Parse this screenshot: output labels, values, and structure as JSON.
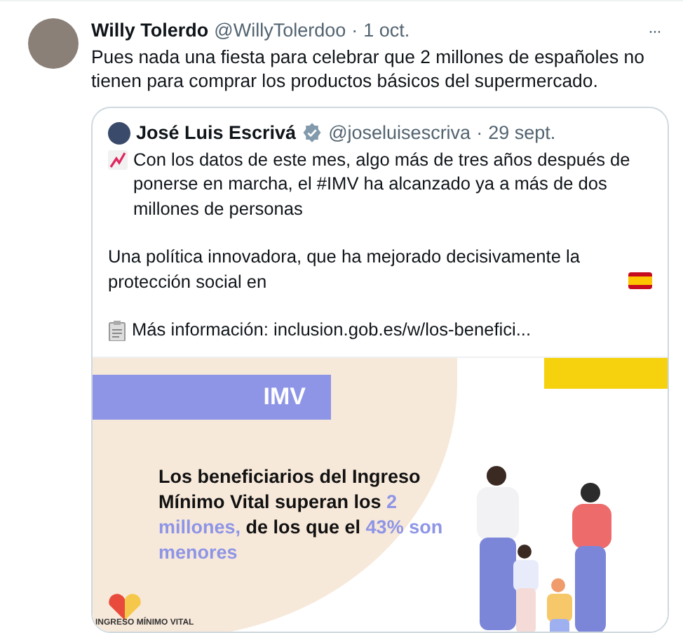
{
  "tweet": {
    "author": "Willy Tolerdo",
    "handle": "@WillyTolerdoo",
    "separator": "·",
    "date": "1 oct.",
    "more": "···",
    "text": "Pues nada una fiesta para celebrar que 2 millones de españoles no tienen para comprar los productos básicos del supermercado."
  },
  "quote": {
    "author": "José Luis Escrivá",
    "verified": true,
    "handle": "@joseluisescriva",
    "separator": "·",
    "date": "29 sept.",
    "paragraphs": [
      {
        "kind": "chart",
        "text": "Con los datos de este mes, algo más de tres años después de ponerse en marcha, el #IMV ha alcanzado ya a más de dos millones de personas"
      },
      {
        "kind": "flag",
        "text": "Una política innovadora, que ha mejorado decisivamente la protección social en"
      },
      {
        "kind": "clipboard",
        "text": "Más información: inclusion.gob.es/w/los-benefici..."
      }
    ],
    "media": {
      "banner": "IMV",
      "headline": [
        {
          "text": "Los beneficiarios del Ingreso Mínimo Vital superan los ",
          "highlight": false
        },
        {
          "text": "2 millones,",
          "highlight": true
        },
        {
          "text": " de los que el ",
          "highlight": false
        },
        {
          "text": "43% son menores",
          "highlight": true
        }
      ],
      "logo_caption": "INGRESO MÍNIMO VITAL"
    }
  }
}
